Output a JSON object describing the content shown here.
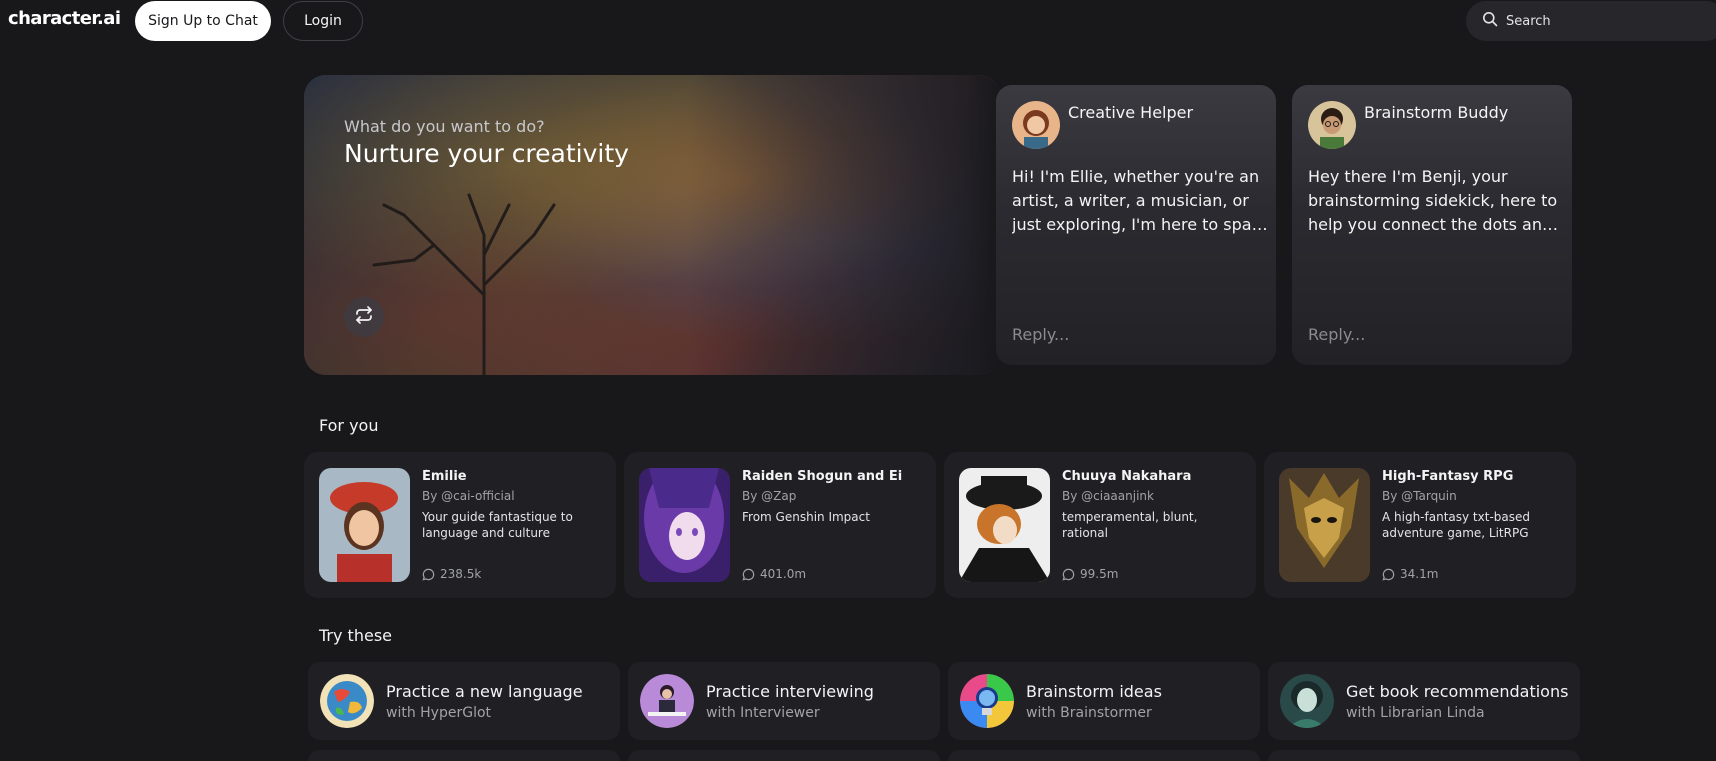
{
  "header": {
    "logo": "character.ai",
    "signup_label": "Sign Up to Chat",
    "login_label": "Login",
    "search_placeholder": "Search"
  },
  "hero": {
    "subtitle": "What do you want to do?",
    "title": "Nurture your creativity"
  },
  "featured_chats": [
    {
      "name": "Creative Helper",
      "message": "Hi! I'm Ellie, whether you're an artist, a writer, a musician, or just exploring, I'm here to spark your creativity",
      "reply_placeholder": "Reply..."
    },
    {
      "name": "Brainstorm Buddy",
      "message": "Hey there I'm Benji, your brainstorming sidekick, here to help you connect the dots and find new ideas",
      "reply_placeholder": "Reply..."
    }
  ],
  "for_you": {
    "title": "For you",
    "items": [
      {
        "name": "Émilie",
        "author": "By @cai-official",
        "description": "Your guide fantastique to language and culture",
        "chats": "238.5k"
      },
      {
        "name": "Raiden Shogun and Ei",
        "author": "By @Zap",
        "description": "From Genshin Impact",
        "chats": "401.0m"
      },
      {
        "name": "Chuuya Nakahara",
        "author": "By @ciaaanjink",
        "description": "temperamental, blunt, rational",
        "chats": "99.5m"
      },
      {
        "name": "High-Fantasy RPG",
        "author": "By @Tarquin",
        "description": "A high-fantasy txt-based adventure game, LitRPG",
        "chats": "34.1m"
      }
    ]
  },
  "try_these": {
    "title": "Try these",
    "items": [
      {
        "title": "Practice a new language",
        "subtitle": "with HyperGlot"
      },
      {
        "title": "Practice interviewing",
        "subtitle": "with Interviewer"
      },
      {
        "title": "Brainstorm ideas",
        "subtitle": "with Brainstormer"
      },
      {
        "title": "Get book recommendations",
        "subtitle": "with Librarian Linda"
      }
    ]
  },
  "icons": {
    "search": "search-icon",
    "refresh": "refresh-icon",
    "chat_count": "chat-bubble-icon"
  },
  "colors": {
    "background": "#18181b",
    "card": "#202024",
    "text": "#f4f4f5",
    "muted": "#a1a1aa"
  }
}
